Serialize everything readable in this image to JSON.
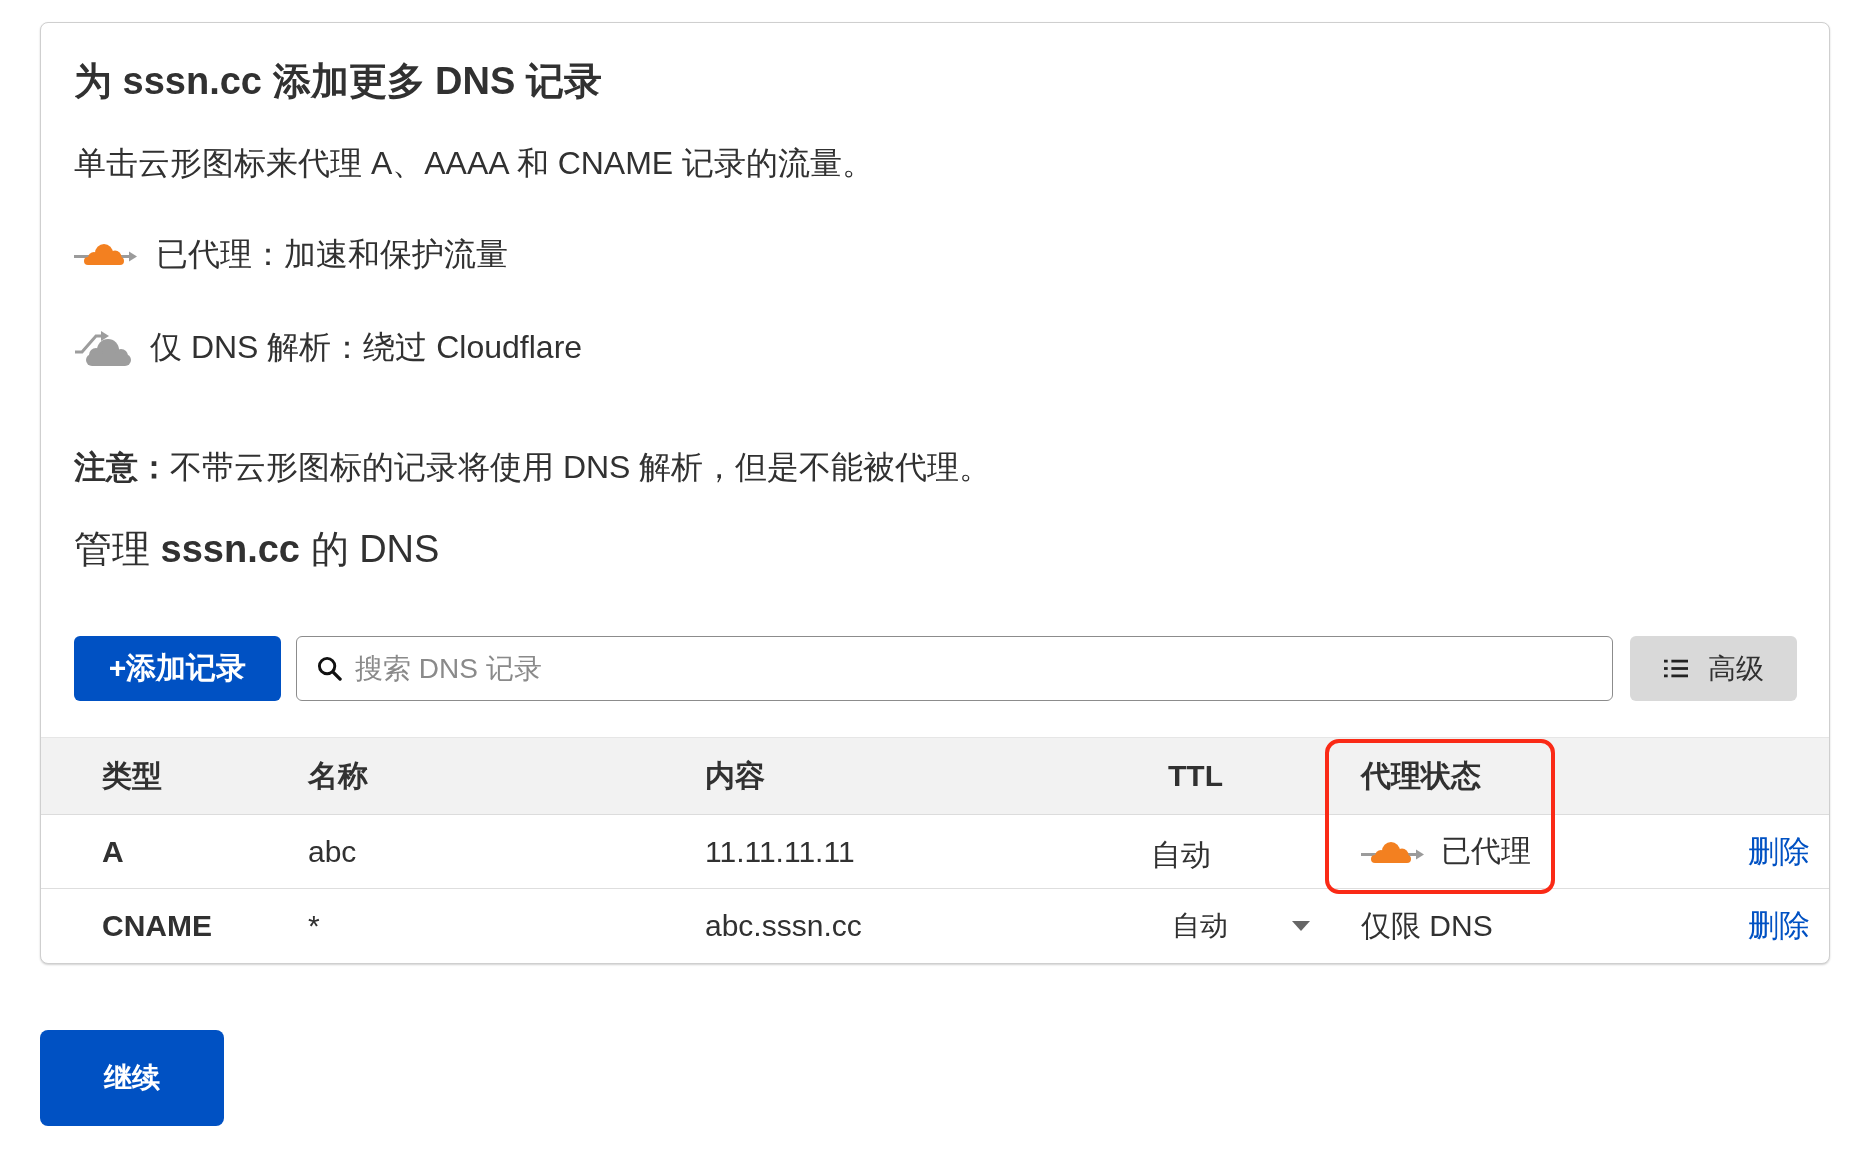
{
  "header": {
    "title": "为 sssn.cc 添加更多 DNS 记录",
    "description": "单击云形图标来代理 A、AAAA 和 CNAME 记录的流量。"
  },
  "legend": [
    {
      "kind": "proxied",
      "text": "已代理：加速和保护流量"
    },
    {
      "kind": "dns_only",
      "text": "仅 DNS 解析：绕过 Cloudflare"
    }
  ],
  "note": "**注意：**不带云形图标的记录将使用 DNS 解析，但是不能被代理。",
  "manage_heading": "管理 **sssn.cc** 的 DNS",
  "toolbar": {
    "add_button": "+添加记录",
    "search": {
      "placeholder": "搜索 DNS 记录"
    },
    "advanced_button": "高级"
  },
  "table": {
    "columns": [
      {
        "label": "类型",
        "highlighted": false
      },
      {
        "label": "名称",
        "highlighted": false
      },
      {
        "label": "内容",
        "highlighted": false
      },
      {
        "label": "TTL",
        "highlighted": false
      },
      {
        "label": "代理状态",
        "highlighted": true
      }
    ],
    "rows": [
      {
        "type": "A",
        "name": "abc",
        "content": "11.11.11.11",
        "ttl": {
          "kind": "text",
          "value": "自动"
        },
        "proxy_status": {
          "kind": "proxied",
          "label": "已代理"
        },
        "action": "删除",
        "highlighted": true
      },
      {
        "type": "CNAME",
        "name": "*",
        "content": "abc.sssn.cc",
        "ttl": {
          "kind": "dropdown",
          "value": "自动"
        },
        "proxy_status": {
          "kind": "dns_only",
          "label": "仅限 DNS"
        },
        "action": "删除",
        "highlighted": false
      }
    ]
  },
  "continue_button": "继续"
}
